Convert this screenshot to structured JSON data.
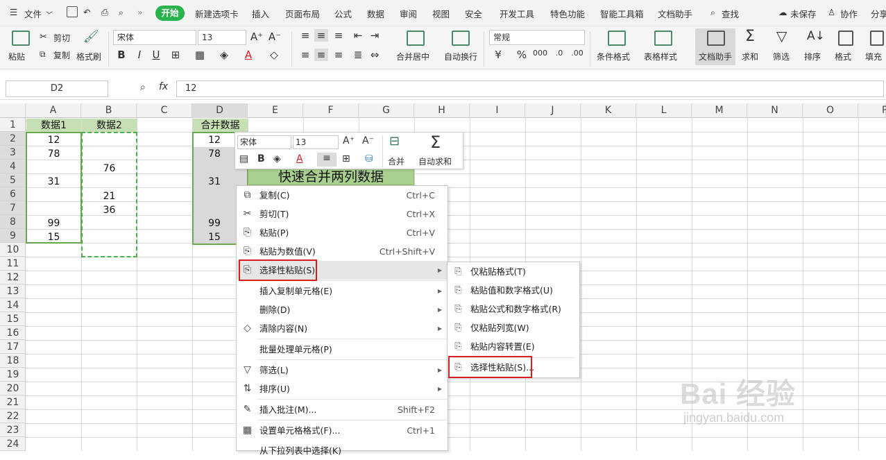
{
  "menubar": {
    "file": "文件",
    "tabs": [
      "开始",
      "新建选项卡",
      "插入",
      "页面布局",
      "公式",
      "数据",
      "审阅",
      "视图",
      "安全",
      "开发工具",
      "特色功能",
      "智能工具箱",
      "文档助手"
    ],
    "search": "查找",
    "unsaved": "未保存",
    "collab": "协作",
    "share": "分享"
  },
  "ribbon": {
    "paste": "粘贴",
    "cut": "剪切",
    "copy": "复制",
    "format_painter": "格式刷",
    "font_name": "宋体",
    "font_size": "13",
    "merge_center": "合并居中",
    "wrap": "自动换行",
    "number_format": "常规",
    "cond_format": "条件格式",
    "table_style": "表格样式",
    "doc_assist": "文档助手",
    "sum": "求和",
    "filter": "筛选",
    "sort": "排序",
    "format": "格式",
    "fill": "填充"
  },
  "formula_bar": {
    "name_box": "D2",
    "fx": "fx",
    "value": "12"
  },
  "grid": {
    "columns": [
      "A",
      "B",
      "C",
      "D",
      "E",
      "F",
      "G",
      "H",
      "I",
      "J",
      "K",
      "L",
      "M",
      "N",
      "O",
      "P"
    ],
    "rows": [
      "1",
      "2",
      "3",
      "4",
      "5",
      "6",
      "7",
      "8",
      "9",
      "10",
      "11",
      "12",
      "13",
      "14",
      "15",
      "16",
      "17",
      "18",
      "19",
      "20",
      "21",
      "22",
      "23",
      "24"
    ],
    "a_header": "数据1",
    "b_header": "数据2",
    "d_header": "合并数据",
    "a_values": [
      "12",
      "78",
      "",
      "31",
      "",
      "",
      "99",
      "15"
    ],
    "b_values": [
      "",
      "",
      "76",
      "",
      "21",
      "36",
      "",
      ""
    ],
    "d_values": [
      "12",
      "78",
      "",
      "31",
      "",
      "",
      "99",
      "15"
    ],
    "banner": "快速合并两列数据"
  },
  "mini_toolbar": {
    "font_name": "宋体",
    "font_size": "13",
    "merge": "合并",
    "autosum": "自动求和"
  },
  "context_menu": {
    "items": [
      {
        "label": "复制(C)",
        "shortcut": "Ctrl+C"
      },
      {
        "label": "剪切(T)",
        "shortcut": "Ctrl+X"
      },
      {
        "label": "粘贴(P)",
        "shortcut": "Ctrl+V"
      },
      {
        "label": "粘贴为数值(V)",
        "shortcut": "Ctrl+Shift+V"
      },
      {
        "label": "选择性粘贴(S)",
        "shortcut": ""
      },
      {
        "label": "插入复制单元格(E)",
        "shortcut": ""
      },
      {
        "label": "删除(D)",
        "shortcut": ""
      },
      {
        "label": "清除内容(N)",
        "shortcut": ""
      },
      {
        "label": "批量处理单元格(P)",
        "shortcut": ""
      },
      {
        "label": "筛选(L)",
        "shortcut": ""
      },
      {
        "label": "排序(U)",
        "shortcut": ""
      },
      {
        "label": "插入批注(M)...",
        "shortcut": "Shift+F2"
      },
      {
        "label": "设置单元格格式(F)...",
        "shortcut": "Ctrl+1"
      },
      {
        "label": "从下拉列表中选择(K)",
        "shortcut": ""
      }
    ]
  },
  "submenu": {
    "items": [
      "仅粘贴格式(T)",
      "粘贴值和数字格式(U)",
      "粘贴公式和数字格式(R)",
      "仅粘贴列宽(W)",
      "粘贴内容转置(E)",
      "选择性粘贴(S)..."
    ]
  },
  "watermark": {
    "brand": "Bai 经验",
    "url": "jingyan.baidu.com"
  }
}
